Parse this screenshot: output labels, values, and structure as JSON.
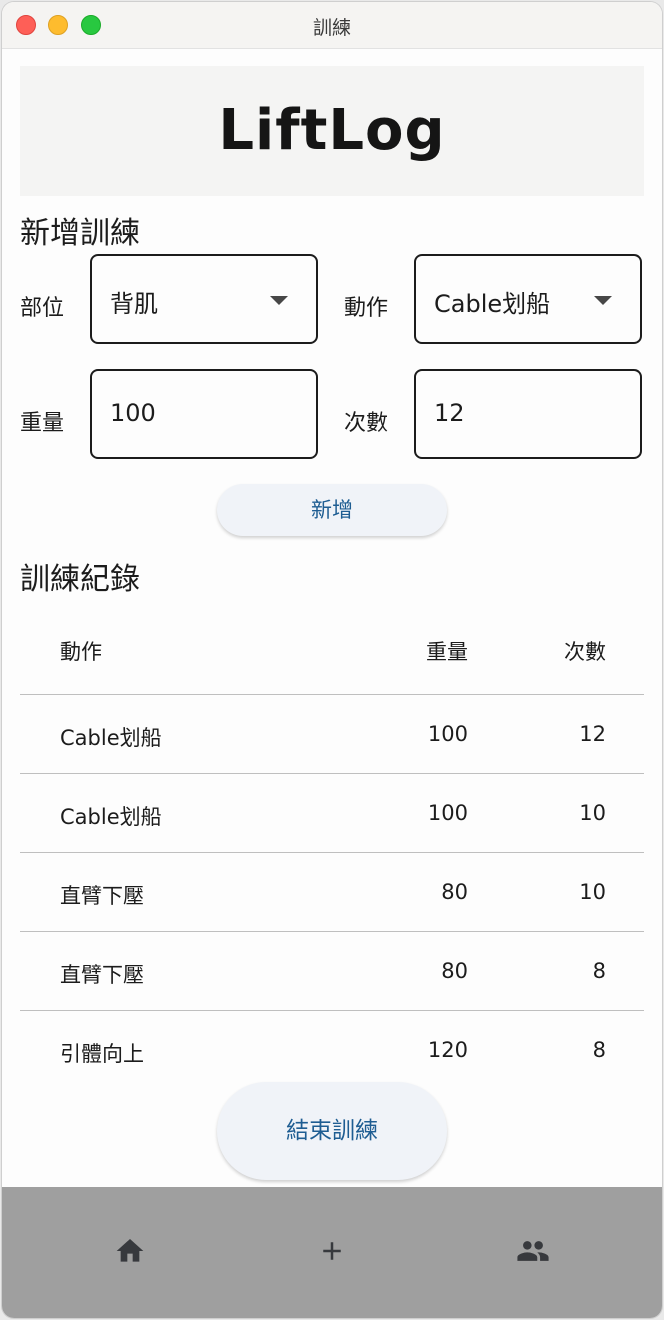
{
  "window": {
    "title": "訓練"
  },
  "app": {
    "title": "LiftLog"
  },
  "form": {
    "section_title": "新增訓練",
    "part_label": "部位",
    "part_value": "背肌",
    "exercise_label": "動作",
    "exercise_value": "Cable划船",
    "weight_label": "重量",
    "weight_value": "100",
    "reps_label": "次數",
    "reps_value": "12",
    "add_label": "新增"
  },
  "log": {
    "section_title": "訓練紀錄",
    "headers": {
      "name": "動作",
      "weight": "重量",
      "reps": "次數"
    },
    "rows": [
      {
        "name": "Cable划船",
        "weight": "100",
        "reps": "12"
      },
      {
        "name": "Cable划船",
        "weight": "100",
        "reps": "10"
      },
      {
        "name": "直臂下壓",
        "weight": "80",
        "reps": "10"
      },
      {
        "name": "直臂下壓",
        "weight": "80",
        "reps": "8"
      },
      {
        "name": "引體向上",
        "weight": "120",
        "reps": "8"
      }
    ]
  },
  "end_label": "結束訓練",
  "nav": {
    "items": [
      "home-icon",
      "add-icon",
      "people-icon"
    ]
  },
  "colors": {
    "accent_text": "#1e5d92",
    "button_bg": "#f0f3f8",
    "nav_bg": "#9f9f9f"
  }
}
